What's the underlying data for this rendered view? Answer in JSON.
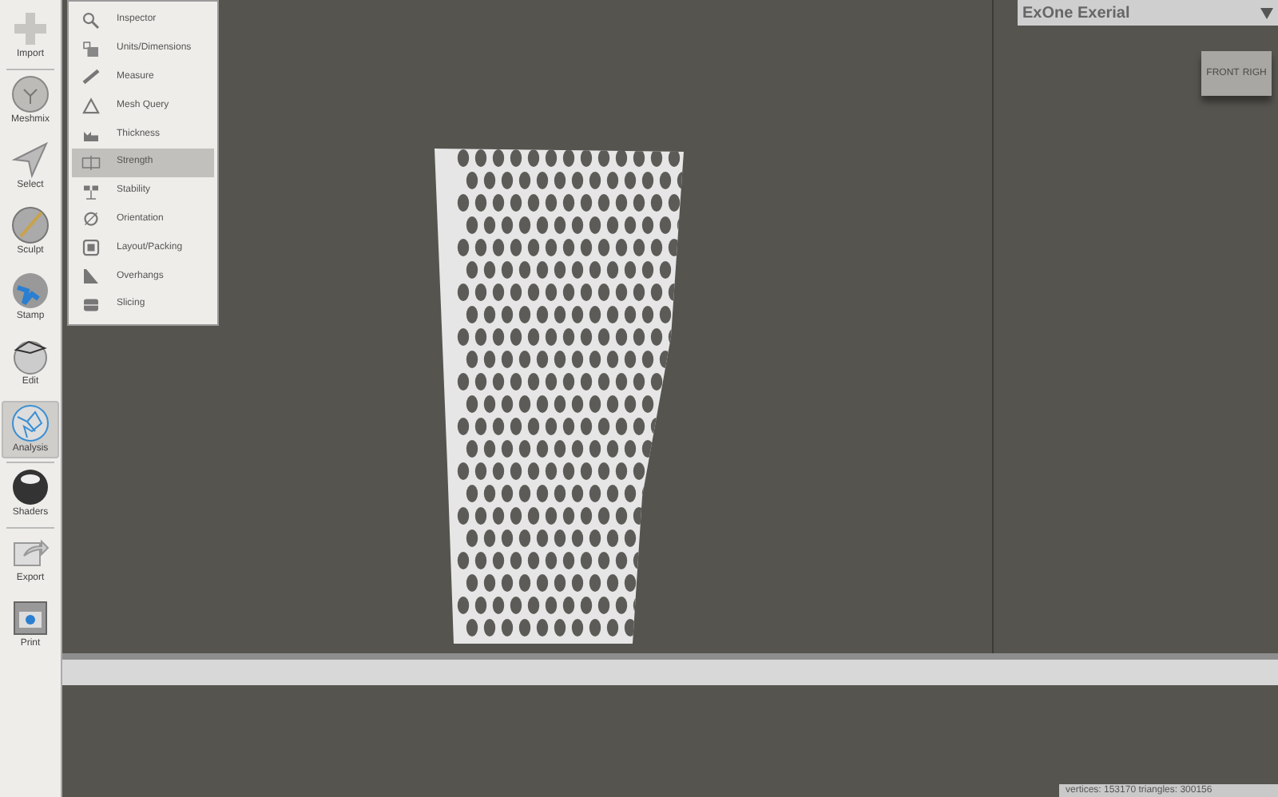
{
  "toolbar": [
    {
      "label": "Import",
      "kind": "plus",
      "selected": false,
      "separator": true
    },
    {
      "label": "Meshmix",
      "kind": "sphere",
      "selected": false,
      "separator": false
    },
    {
      "label": "Select",
      "kind": "arrow",
      "selected": false,
      "separator": false
    },
    {
      "label": "Sculpt",
      "kind": "brush",
      "selected": false,
      "separator": false
    },
    {
      "label": "Stamp",
      "kind": "stamp",
      "selected": false,
      "separator": false
    },
    {
      "label": "Edit",
      "kind": "edit",
      "selected": false,
      "separator": false
    },
    {
      "label": "Analysis",
      "kind": "analysis",
      "selected": true,
      "separator": true
    },
    {
      "label": "Shaders",
      "kind": "shader",
      "selected": false,
      "separator": true
    },
    {
      "label": "Export",
      "kind": "export",
      "selected": false,
      "separator": false
    },
    {
      "label": "Print",
      "kind": "print",
      "selected": false,
      "separator": false
    }
  ],
  "menu": [
    {
      "label": "Inspector",
      "selected": false
    },
    {
      "label": "Units/Dimensions",
      "selected": false
    },
    {
      "label": "Measure",
      "selected": false
    },
    {
      "label": "Mesh Query",
      "selected": false
    },
    {
      "label": "Thickness",
      "selected": false
    },
    {
      "label": "Strength",
      "selected": true
    },
    {
      "label": "Stability",
      "selected": false
    },
    {
      "label": "Orientation",
      "selected": false
    },
    {
      "label": "Layout/Packing",
      "selected": false
    },
    {
      "label": "Overhangs",
      "selected": false
    },
    {
      "label": "Slicing",
      "selected": false
    }
  ],
  "printer_panel": {
    "title": "ExOne Exerial",
    "view_cube": [
      "FRONT",
      "RIGH"
    ]
  },
  "status_bar": "vertices: 153170 triangles: 300156"
}
